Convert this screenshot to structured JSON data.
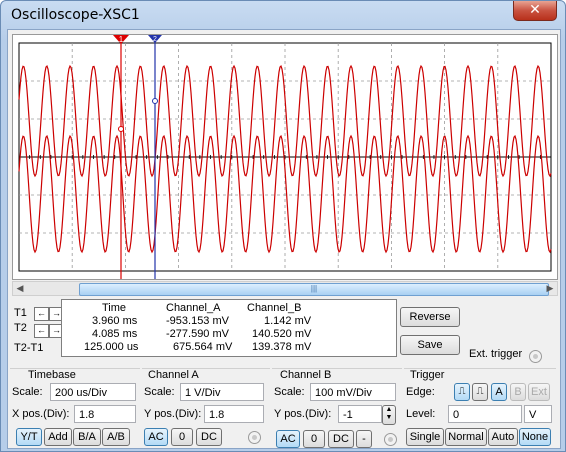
{
  "window": {
    "title": "Oscilloscope-XSC1",
    "close_glyph": "✕"
  },
  "screen": {
    "cursor1_label": "1",
    "cursor2_label": "2",
    "trace_color": "#cc0000",
    "cursor1_color": "#dd0000",
    "cursor2_color": "#2233aa",
    "grid_color": "#9a9a9a"
  },
  "scroll": {
    "thumb_glyph": "|||"
  },
  "cursors": {
    "t1_label": "T1",
    "t2_label": "T2",
    "t2t1_label": "T2-T1",
    "left_glyph": "←",
    "right_glyph": "→"
  },
  "readout": {
    "headers": [
      "Time",
      "Channel_A",
      "Channel_B"
    ],
    "rows": [
      [
        "3.960 ms",
        "-953.153 mV",
        "1.142 mV"
      ],
      [
        "4.085 ms",
        "-277.590 mV",
        "140.520 mV"
      ],
      [
        "125.000 us",
        "675.564 mV",
        "139.378 mV"
      ]
    ]
  },
  "actions": {
    "reverse": "Reverse",
    "save": "Save",
    "ext_trigger": "Ext. trigger"
  },
  "timebase": {
    "title": "Timebase",
    "scale_label": "Scale:",
    "scale_value": "200 us/Div",
    "xpos_label": "X pos.(Div):",
    "xpos_value": "1.8",
    "modes": [
      "Y/T",
      "Add",
      "B/A",
      "A/B"
    ]
  },
  "channel_a": {
    "title": "Channel A",
    "scale_label": "Scale:",
    "scale_value": "1  V/Div",
    "ypos_label": "Y pos.(Div):",
    "ypos_value": "1.8",
    "coupling": [
      "AC",
      "0",
      "DC"
    ]
  },
  "channel_b": {
    "title": "Channel B",
    "scale_label": "Scale:",
    "scale_value": "100 mV/Div",
    "ypos_label": "Y pos.(Div):",
    "ypos_value": "-1",
    "coupling": [
      "AC",
      "0",
      "DC",
      "-"
    ]
  },
  "trigger": {
    "title": "Trigger",
    "edge_label": "Edge:",
    "level_label": "Level:",
    "level_value": "0",
    "level_unit": "V",
    "sources": [
      "A",
      "B",
      "Ext"
    ],
    "modes": [
      "Single",
      "Normal",
      "Auto",
      "None"
    ]
  }
}
